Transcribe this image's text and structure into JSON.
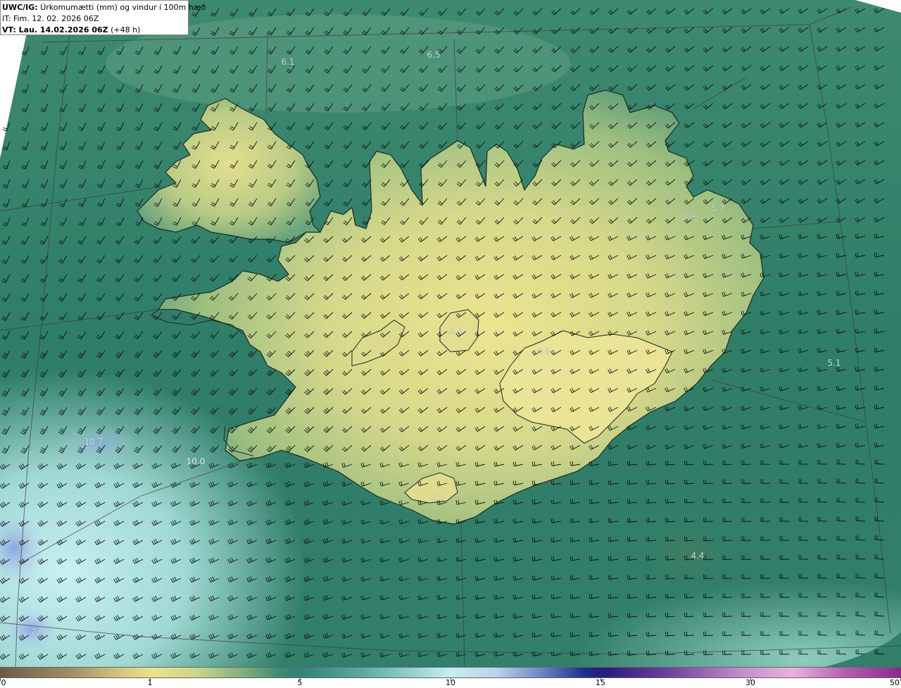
{
  "header": {
    "model": "UWC/IG:",
    "title": "Úrkomumætti (mm) og vindur í 100m hæð",
    "init_time": "IT: Fim. 12. 02. 2026 06Z",
    "valid_prefix": "VT: Lau. 14.02.2026 06Z",
    "valid_suffix": "(+48 h)"
  },
  "field_labels": [
    {
      "text": "6.1",
      "tone": "light"
    },
    {
      "text": "6.5",
      "tone": "light"
    },
    {
      "text": "2.9",
      "tone": "light"
    },
    {
      "text": "5.7",
      "tone": "light"
    },
    {
      "text": "5.1",
      "tone": "light"
    },
    {
      "text": "1.4",
      "tone": "light"
    },
    {
      "text": "0.9",
      "tone": "light"
    },
    {
      "text": "10.7",
      "tone": "faint"
    },
    {
      "text": "10.0",
      "tone": "faint"
    },
    {
      "text": "2.3",
      "tone": "light"
    },
    {
      "text": "4.4",
      "tone": "light"
    },
    {
      "text": "2.6",
      "tone": "faint"
    }
  ],
  "colorbar": {
    "ticks": [
      {
        "value": "0",
        "frac": 0.0
      },
      {
        "value": "1",
        "frac": 0.1667
      },
      {
        "value": "5",
        "frac": 0.3333
      },
      {
        "value": "10",
        "frac": 0.5
      },
      {
        "value": "15",
        "frac": 0.6667
      },
      {
        "value": "30",
        "frac": 0.8333
      },
      {
        "value": "50",
        "frac": 1.0
      }
    ]
  },
  "colors": {
    "land_bright": "#e7e28f",
    "land_mid": "#b8c97f",
    "sea_green": "#2e7f68",
    "sea_teal": "#6fb9a8",
    "sea_light": "#c4eef0",
    "sea_blue": "#9fb8e6"
  }
}
